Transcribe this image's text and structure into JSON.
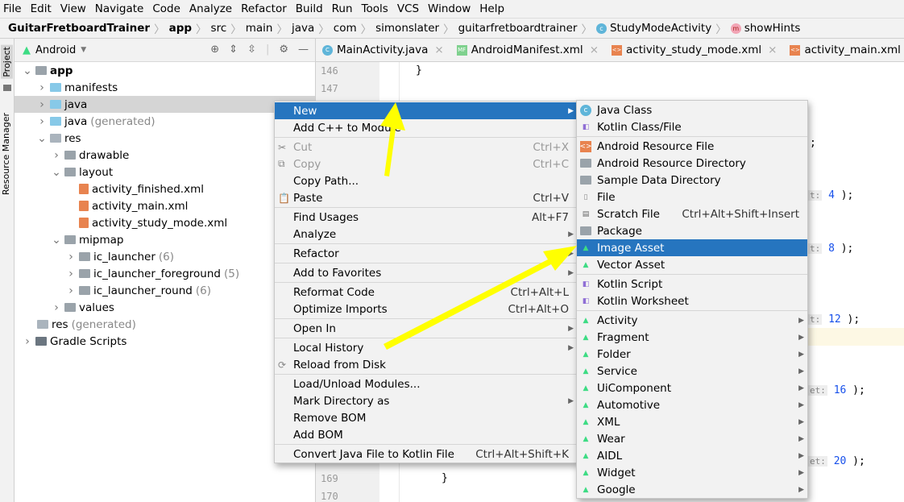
{
  "menubar": [
    "File",
    "Edit",
    "View",
    "Navigate",
    "Code",
    "Analyze",
    "Refactor",
    "Build",
    "Run",
    "Tools",
    "VCS",
    "Window",
    "Help"
  ],
  "breadcrumb": {
    "project": "GuitarFretboardTrainer",
    "module": "app",
    "parts": [
      "src",
      "main",
      "java",
      "com",
      "simonslater",
      "guitarfretboardtrainer"
    ],
    "class": "StudyModeActivity",
    "method": "showHints"
  },
  "sidebar_tabs": {
    "project": "Project",
    "resource_manager": "Resource Manager"
  },
  "project_panel": {
    "view": "Android"
  },
  "tree": [
    {
      "label": "app",
      "level": 0,
      "chev": "v",
      "icon": "module",
      "bold": true
    },
    {
      "label": "manifests",
      "level": 1,
      "chev": ">",
      "icon": "folder"
    },
    {
      "label": "java",
      "level": 1,
      "chev": ">",
      "icon": "folder",
      "selected": true
    },
    {
      "label": "java",
      "suffix": "(generated)",
      "level": 1,
      "chev": ">",
      "icon": "folder-gen"
    },
    {
      "label": "res",
      "level": 1,
      "chev": "v",
      "icon": "res"
    },
    {
      "label": "drawable",
      "level": 2,
      "chev": ">",
      "icon": "gray-folder"
    },
    {
      "label": "layout",
      "level": 2,
      "chev": "v",
      "icon": "gray-folder"
    },
    {
      "label": "activity_finished.xml",
      "level": 3,
      "icon": "xml"
    },
    {
      "label": "activity_main.xml",
      "level": 3,
      "icon": "xml"
    },
    {
      "label": "activity_study_mode.xml",
      "level": 3,
      "icon": "xml"
    },
    {
      "label": "mipmap",
      "level": 2,
      "chev": "v",
      "icon": "gray-folder"
    },
    {
      "label": "ic_launcher",
      "suffix": "(6)",
      "level": 3,
      "chev": ">",
      "icon": "gray-folder"
    },
    {
      "label": "ic_launcher_foreground",
      "suffix": "(5)",
      "level": 3,
      "chev": ">",
      "icon": "gray-folder"
    },
    {
      "label": "ic_launcher_round",
      "suffix": "(6)",
      "level": 3,
      "chev": ">",
      "icon": "gray-folder"
    },
    {
      "label": "values",
      "level": 2,
      "chev": ">",
      "icon": "gray-folder"
    },
    {
      "label": "res",
      "suffix": "(generated)",
      "level": 1,
      "icon": "res"
    },
    {
      "label": "Gradle Scripts",
      "level": 0,
      "chev": ">",
      "icon": "gradle"
    }
  ],
  "editor_tabs": [
    {
      "label": "MainActivity.java",
      "icon": "C",
      "color": "#5fb5d9"
    },
    {
      "label": "AndroidManifest.xml",
      "icon": "MF",
      "color": "#7fd18e"
    },
    {
      "label": "activity_study_mode.xml",
      "icon": "<>",
      "color": "#e8834f"
    },
    {
      "label": "activity_main.xml",
      "icon": "<>",
      "color": "#e8834f"
    }
  ],
  "code": {
    "lines": [
      "146",
      "147",
      "169",
      "170"
    ],
    "brace1": "}",
    "brace2": "}",
    "semi": ";",
    "hint_a": "t:",
    "hint_b": "et:",
    "v4": "4",
    "v8": "8",
    "v12": "12",
    "v16": "16",
    "v20": "20",
    "close": " );"
  },
  "context_menu": [
    {
      "label": "New",
      "arrow": true,
      "hl": true
    },
    {
      "label": "Add C++ to Module"
    },
    {
      "sep": true
    },
    {
      "label": "Cut",
      "shortcut": "Ctrl+X",
      "dis": true,
      "icon": "✂"
    },
    {
      "label": "Copy",
      "shortcut": "Ctrl+C",
      "dis": true,
      "icon": "⧉"
    },
    {
      "label": "Copy Path...",
      "shortcut": ""
    },
    {
      "label": "Paste",
      "shortcut": "Ctrl+V",
      "icon": "📋"
    },
    {
      "sep": true
    },
    {
      "label": "Find Usages",
      "shortcut": "Alt+F7"
    },
    {
      "label": "Analyze",
      "arrow": true
    },
    {
      "sep": true
    },
    {
      "label": "Refactor",
      "arrow": true
    },
    {
      "sep": true
    },
    {
      "label": "Add to Favorites",
      "arrow": true
    },
    {
      "sep": true
    },
    {
      "label": "Reformat Code",
      "shortcut": "Ctrl+Alt+L"
    },
    {
      "label": "Optimize Imports",
      "shortcut": "Ctrl+Alt+O"
    },
    {
      "sep": true
    },
    {
      "label": "Open In",
      "arrow": true
    },
    {
      "sep": true
    },
    {
      "label": "Local History",
      "arrow": true
    },
    {
      "label": "Reload from Disk",
      "icon": "⟳"
    },
    {
      "sep": true
    },
    {
      "label": "Load/Unload Modules..."
    },
    {
      "label": "Mark Directory as",
      "arrow": true
    },
    {
      "label": "Remove BOM"
    },
    {
      "label": "Add BOM"
    },
    {
      "sep": true
    },
    {
      "label": "Convert Java File to Kotlin File",
      "shortcut": "Ctrl+Alt+Shift+K"
    }
  ],
  "submenu": [
    {
      "label": "Java Class",
      "icon": "class"
    },
    {
      "label": "Kotlin Class/File",
      "icon": "kotlin"
    },
    {
      "sep": true
    },
    {
      "label": "Android Resource File",
      "icon": "xml"
    },
    {
      "label": "Android Resource Directory",
      "icon": "folder"
    },
    {
      "label": "Sample Data Directory",
      "icon": "folder"
    },
    {
      "label": "File",
      "icon": "file"
    },
    {
      "label": "Scratch File",
      "shortcut": "Ctrl+Alt+Shift+Insert",
      "icon": "scratch"
    },
    {
      "label": "Package",
      "icon": "folder"
    },
    {
      "label": "Image Asset",
      "icon": "android",
      "hl": true
    },
    {
      "label": "Vector Asset",
      "icon": "android"
    },
    {
      "sep": true
    },
    {
      "label": "Kotlin Script",
      "icon": "kotlin"
    },
    {
      "label": "Kotlin Worksheet",
      "icon": "kotlin"
    },
    {
      "sep": true
    },
    {
      "label": "Activity",
      "icon": "android",
      "arrow": true
    },
    {
      "label": "Fragment",
      "icon": "android",
      "arrow": true
    },
    {
      "label": "Folder",
      "icon": "android",
      "arrow": true
    },
    {
      "label": "Service",
      "icon": "android",
      "arrow": true
    },
    {
      "label": "UiComponent",
      "icon": "android",
      "arrow": true
    },
    {
      "label": "Automotive",
      "icon": "android",
      "arrow": true
    },
    {
      "label": "XML",
      "icon": "android",
      "arrow": true
    },
    {
      "label": "Wear",
      "icon": "android",
      "arrow": true
    },
    {
      "label": "AIDL",
      "icon": "android",
      "arrow": true
    },
    {
      "label": "Widget",
      "icon": "android",
      "arrow": true
    },
    {
      "label": "Google",
      "icon": "android",
      "arrow": true
    }
  ],
  "colors": {
    "highlight": "#2675bf",
    "arrow": "#ffff00",
    "android": "#3ddc84"
  }
}
